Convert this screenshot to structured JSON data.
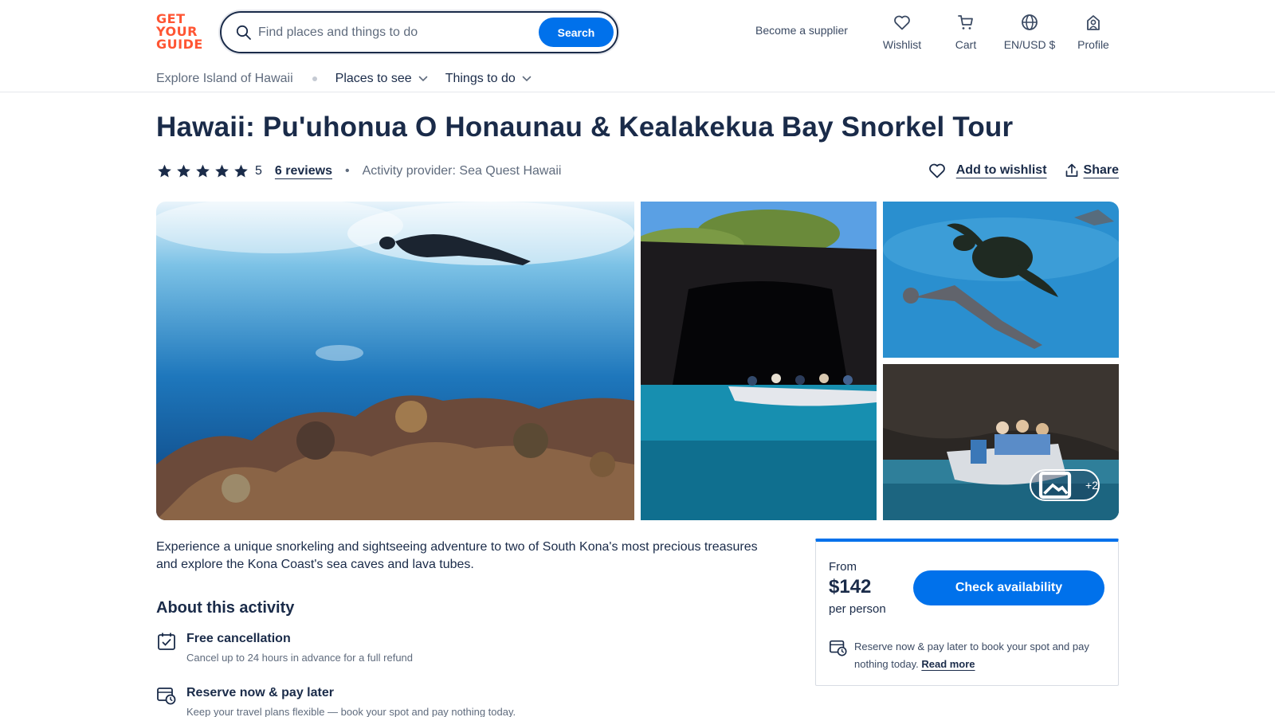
{
  "brand": {
    "logo_lines": [
      "GET",
      "YOUR",
      "GUIDE"
    ],
    "color": "#ff5533",
    "accent": "#0071eb",
    "text": "#1a2b49"
  },
  "search": {
    "placeholder": "Find places and things to do",
    "button": "Search"
  },
  "header": {
    "supplier": "Become a supplier",
    "nav": [
      {
        "label": "Wishlist",
        "icon": "heart-icon"
      },
      {
        "label": "Cart",
        "icon": "cart-icon"
      },
      {
        "label": "EN/USD $",
        "icon": "globe-icon"
      },
      {
        "label": "Profile",
        "icon": "profile-icon"
      }
    ]
  },
  "subnav": {
    "crumb": "Explore Island of Hawaii",
    "places": "Places to see",
    "things": "Things to do"
  },
  "product": {
    "title": "Hawaii: Pu'uhonua O Honaunau & Kealakekua Bay Snorkel Tour",
    "rating": "5",
    "stars": 5,
    "reviews": "6 reviews",
    "provider": "Activity provider: Sea Quest Hawaii",
    "wishlist": "Add to wishlist",
    "share": "Share"
  },
  "gallery": {
    "more": "+2"
  },
  "content": {
    "intro": "Experience a unique snorkeling and sightseeing adventure to two of South Kona's most precious treasures and explore the Kona Coast's sea caves and lava tubes.",
    "about_title": "About this activity",
    "features": [
      {
        "title": "Free cancellation",
        "desc": "Cancel up to 24 hours in advance for a full refund"
      },
      {
        "title": "Reserve now & pay later",
        "desc": "Keep your travel plans flexible — book your spot and pay nothing today."
      }
    ]
  },
  "booking": {
    "from": "From",
    "price": "$142",
    "per": "per person",
    "button": "Check availability",
    "note": "Reserve now & pay later to book your spot and pay nothing today.",
    "read_more": "Read more"
  }
}
